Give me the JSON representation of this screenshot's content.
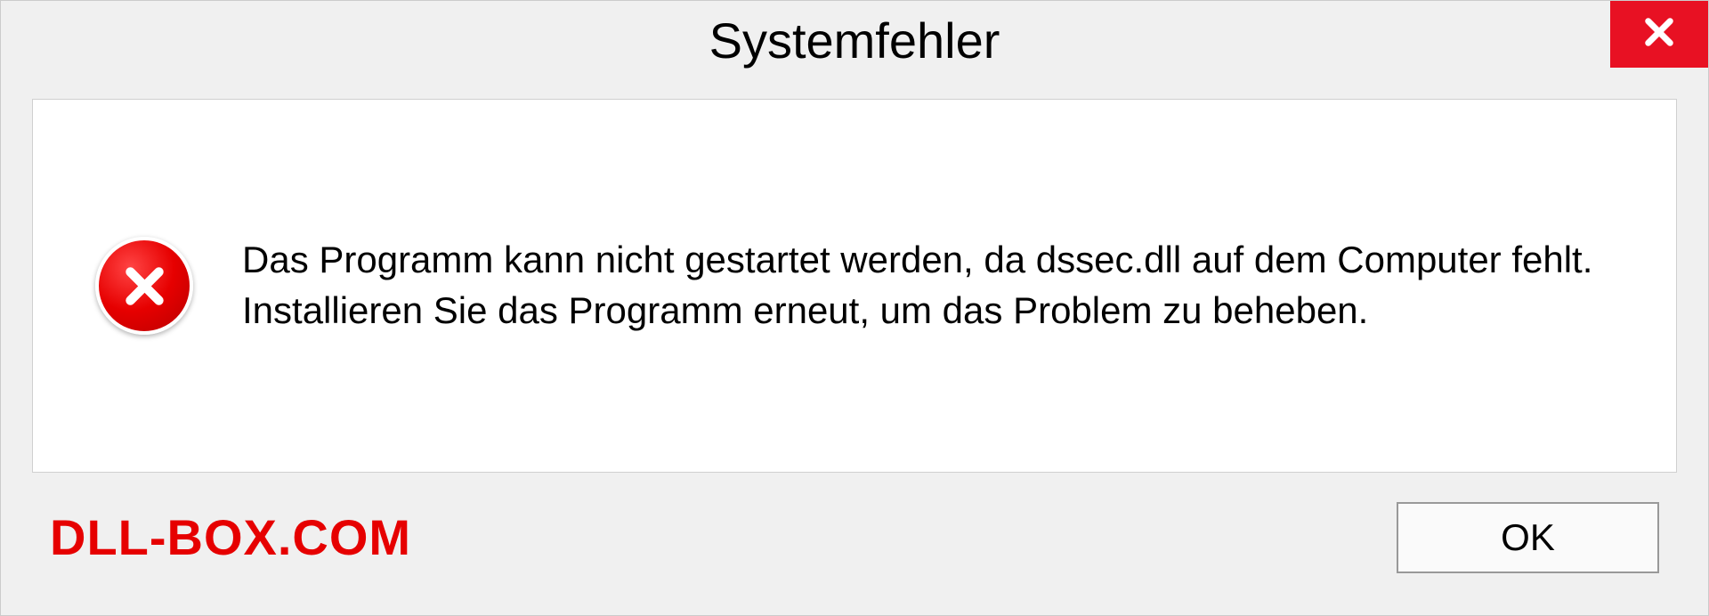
{
  "dialog": {
    "title": "Systemfehler",
    "message": "Das Programm kann nicht gestartet werden, da dssec.dll auf dem Computer fehlt. Installieren Sie das Programm erneut, um das Problem zu beheben.",
    "ok_label": "OK"
  },
  "watermark": "DLL-BOX.COM",
  "colors": {
    "close_button": "#e81123",
    "error_red": "#e60000",
    "watermark_red": "#e60000"
  }
}
